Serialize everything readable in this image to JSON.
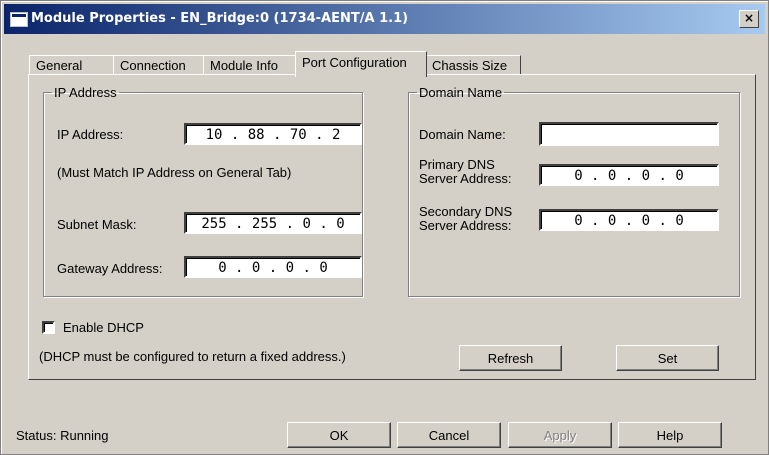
{
  "window": {
    "title": "Module Properties - EN_Bridge:0 (1734-AENT/A 1.1)",
    "close_label": "×"
  },
  "tabs": [
    {
      "label": "General"
    },
    {
      "label": "Connection"
    },
    {
      "label": "Module Info"
    },
    {
      "label": "Port Configuration"
    },
    {
      "label": "Chassis Size"
    }
  ],
  "active_tab": "Port Configuration",
  "ip_group": {
    "legend": "IP Address",
    "ip_label": "IP Address:",
    "ip_value": "10 . 88 . 70 . 2",
    "note": "(Must Match IP Address on General Tab)",
    "subnet_label": "Subnet Mask:",
    "subnet_value": "255 . 255 . 0 . 0",
    "gateway_label": "Gateway Address:",
    "gateway_value": "0 . 0 . 0 . 0"
  },
  "domain_group": {
    "legend": "Domain Name",
    "domain_label": "Domain Name:",
    "domain_value": "",
    "primary_label_1": "Primary DNS",
    "primary_label_2": "Server Address:",
    "primary_value": "0 . 0 . 0 . 0",
    "secondary_label_1": "Secondary DNS",
    "secondary_label_2": "Server Address:",
    "secondary_value": "0 . 0 . 0 . 0"
  },
  "dhcp": {
    "label": "Enable DHCP",
    "checked": false,
    "note": "(DHCP must be configured to return a fixed address.)"
  },
  "panel_buttons": {
    "refresh": "Refresh",
    "set": "Set"
  },
  "status": {
    "text": "Status:  Running"
  },
  "footer_buttons": {
    "ok": "OK",
    "cancel": "Cancel",
    "apply": "Apply",
    "help": "Help"
  }
}
